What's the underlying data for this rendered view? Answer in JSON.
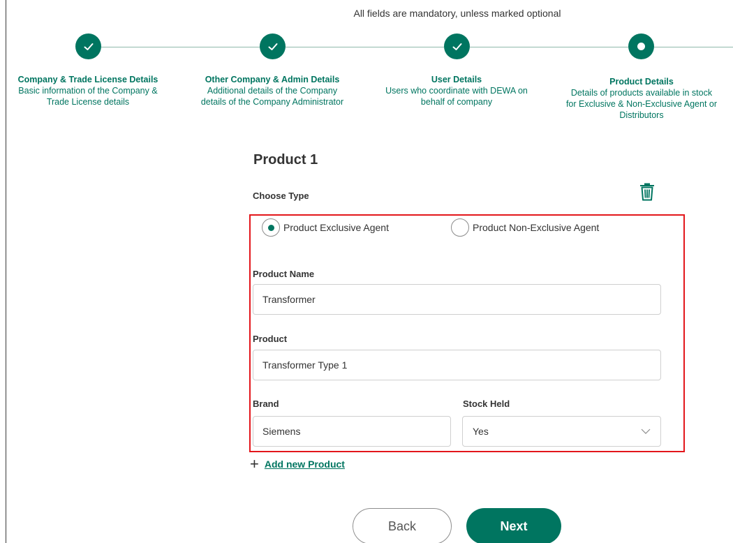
{
  "form": {
    "mandatory_note": "All fields are mandatory, unless marked optional"
  },
  "stepper": {
    "steps": [
      {
        "title": "Company & Trade License Details",
        "desc_line1": "Basic information of the Company &",
        "desc_line2": "Trade License details",
        "desc_line3": "",
        "status": "completed"
      },
      {
        "title": "Other Company & Admin Details",
        "desc_line1": "Additional details of the Company",
        "desc_line2": "details of the Company Administrator",
        "desc_line3": "",
        "status": "completed"
      },
      {
        "title": "User Details",
        "desc_line1": "Users who coordinate with DEWA on",
        "desc_line2": "behalf of company",
        "desc_line3": "",
        "status": "completed"
      },
      {
        "title": "Product Details",
        "desc_line1": "Details of products available in stock",
        "desc_line2": "for Exclusive & Non-Exclusive Agent or",
        "desc_line3": "Distributors",
        "status": "current"
      }
    ]
  },
  "product": {
    "heading": "Product 1",
    "choose_type_label": "Choose Type",
    "delete_icon": "trash-icon",
    "options": [
      {
        "label": "Product Exclusive Agent",
        "selected": true
      },
      {
        "label": "Product Non-Exclusive Agent",
        "selected": false
      }
    ],
    "name_label": "Product Name",
    "name_value": "Transformer",
    "product_label": "Product",
    "product_value": "Transformer Type 1",
    "brand_label": "Brand",
    "brand_value": "Siemens",
    "stock_label": "Stock Held",
    "stock_value": "Yes"
  },
  "actions": {
    "add_product": "Add new Product",
    "back": "Back",
    "next": "Next"
  },
  "colors": {
    "brand_green": "#007560",
    "highlight_red": "#e3161b",
    "text": "#333333"
  }
}
